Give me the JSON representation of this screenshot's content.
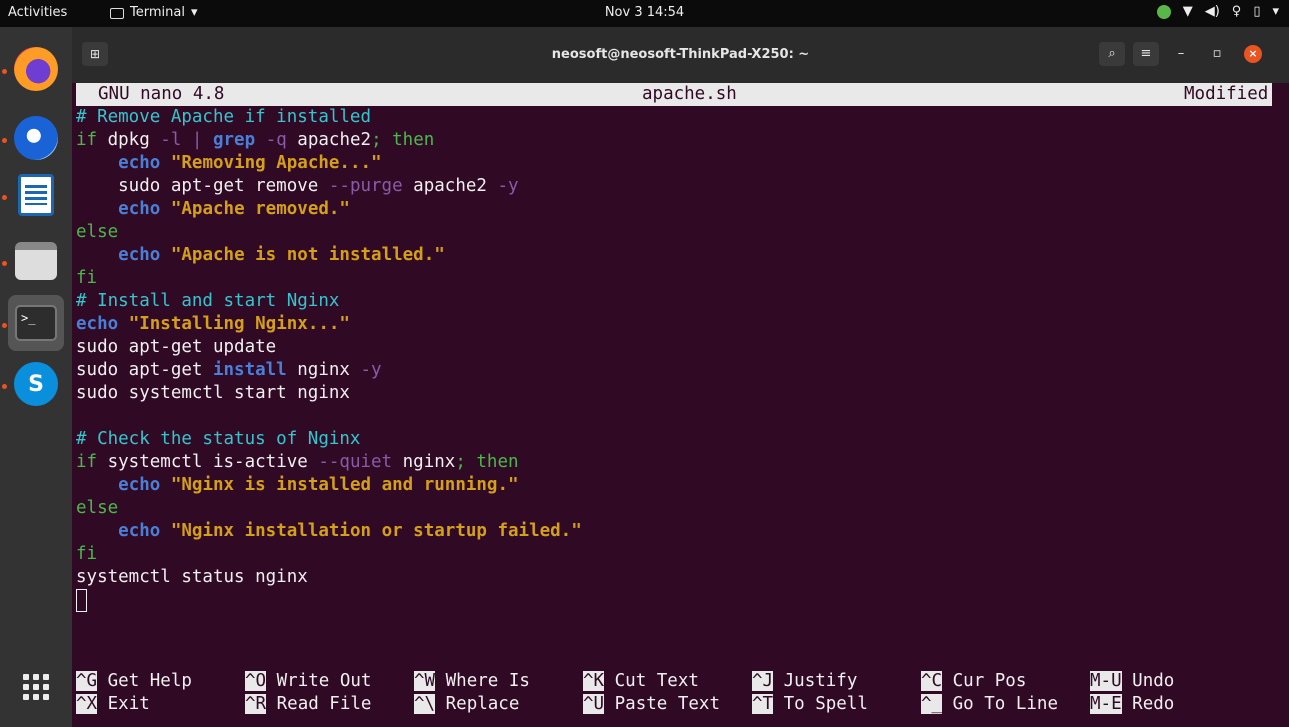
{
  "topbar": {
    "activities": "Activities",
    "app_name": "Terminal",
    "clock": "Nov 3  14:54"
  },
  "window": {
    "title": "neosoft@neosoft-ThinkPad-X250: ~"
  },
  "nano": {
    "version": "GNU nano 4.8",
    "filename": "apache.sh",
    "status": "Modified",
    "code": {
      "l1": "# Remove Apache if installed",
      "l2a": "if",
      "l2b": " dpkg ",
      "l2c": "-l",
      "l2d": " | ",
      "l2e": "grep",
      "l2f": " ",
      "l2g": "-q",
      "l2h": " apache2",
      "l2i": "; then",
      "l3a": "    ",
      "l3b": "echo",
      "l3c": " ",
      "l3d": "\"Removing Apache...\"",
      "l4a": "    sudo apt-get remove ",
      "l4b": "--purge",
      "l4c": " apache2 ",
      "l4d": "-y",
      "l5a": "    ",
      "l5b": "echo",
      "l5c": " ",
      "l5d": "\"Apache removed.\"",
      "l6": "else",
      "l7a": "    ",
      "l7b": "echo",
      "l7c": " ",
      "l7d": "\"Apache is not installed.\"",
      "l8": "fi",
      "l9": "# Install and start Nginx",
      "l10a": "echo",
      "l10b": " ",
      "l10c": "\"Installing Nginx...\"",
      "l11": "sudo apt-get update",
      "l12a": "sudo apt-get ",
      "l12b": "install",
      "l12c": " nginx ",
      "l12d": "-y",
      "l13": "sudo systemctl start nginx",
      "l15": "# Check the status of Nginx",
      "l16a": "if",
      "l16b": " systemctl is-active ",
      "l16c": "--quiet",
      "l16d": " nginx",
      "l16e": "; then",
      "l17a": "    ",
      "l17b": "echo",
      "l17c": " ",
      "l17d": "\"Nginx is installed and running.\"",
      "l18": "else",
      "l19a": "    ",
      "l19b": "echo",
      "l19c": " ",
      "l19d": "\"Nginx installation or startup failed.\"",
      "l20": "fi",
      "l21": "systemctl status nginx"
    },
    "shortcuts_row1": [
      {
        "key": "^G",
        "label": "Get Help"
      },
      {
        "key": "^O",
        "label": "Write Out"
      },
      {
        "key": "^W",
        "label": "Where Is"
      },
      {
        "key": "^K",
        "label": "Cut Text"
      },
      {
        "key": "^J",
        "label": "Justify"
      },
      {
        "key": "^C",
        "label": "Cur Pos"
      },
      {
        "key": "M-U",
        "label": "Undo"
      }
    ],
    "shortcuts_row2": [
      {
        "key": "^X",
        "label": "Exit"
      },
      {
        "key": "^R",
        "label": "Read File"
      },
      {
        "key": "^\\",
        "label": "Replace"
      },
      {
        "key": "^U",
        "label": "Paste Text"
      },
      {
        "key": "^T",
        "label": "To Spell"
      },
      {
        "key": "^_",
        "label": "Go To Line"
      },
      {
        "key": "M-E",
        "label": "Redo"
      }
    ]
  },
  "colors": {
    "terminal_bg": "#300a24",
    "accent": "#e95420",
    "comment": "#34c6ce",
    "string": "#d4a017",
    "keyword": "#4ab84a"
  }
}
